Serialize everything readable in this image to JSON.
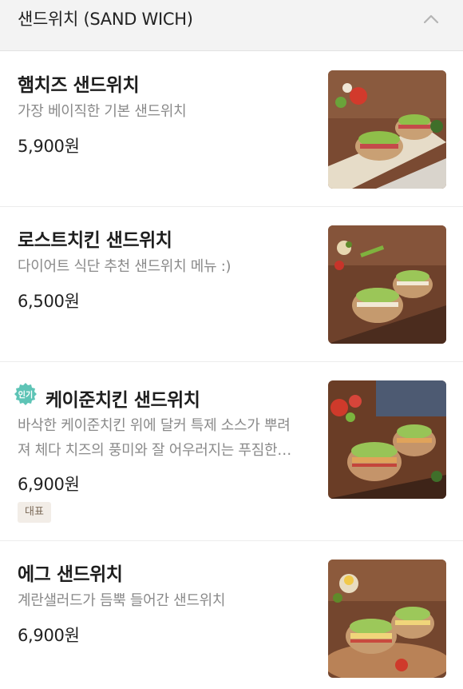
{
  "category": {
    "title": "샌드위치 (SAND WICH)"
  },
  "items": [
    {
      "name": "햄치즈 샌드위치",
      "description": "가장 베이직한 기본 샌드위치",
      "price": "5,900원"
    },
    {
      "name": "로스트치킨 샌드위치",
      "description": "다이어트 식단 추천 샌드위치 메뉴 :)",
      "price": "6,500원"
    },
    {
      "name": "케이준치킨 샌드위치",
      "badge": "인기",
      "description_line1": "바삭한 케이준치킨 위에 달커 특제 소스가 뿌려",
      "description_line2": "져 체다 치즈의 풍미와 잘 어우러지는 푸짐한…",
      "price": "6,900원",
      "tag": "대표"
    },
    {
      "name": "에그 샌드위치",
      "description": "계란샐러드가 듬뿍 들어간 샌드위치",
      "price": "6,900원"
    }
  ],
  "colors": {
    "badge": "#5ec4b6",
    "tag_bg": "#f2ede7",
    "header_bg": "#f3f3f3"
  }
}
